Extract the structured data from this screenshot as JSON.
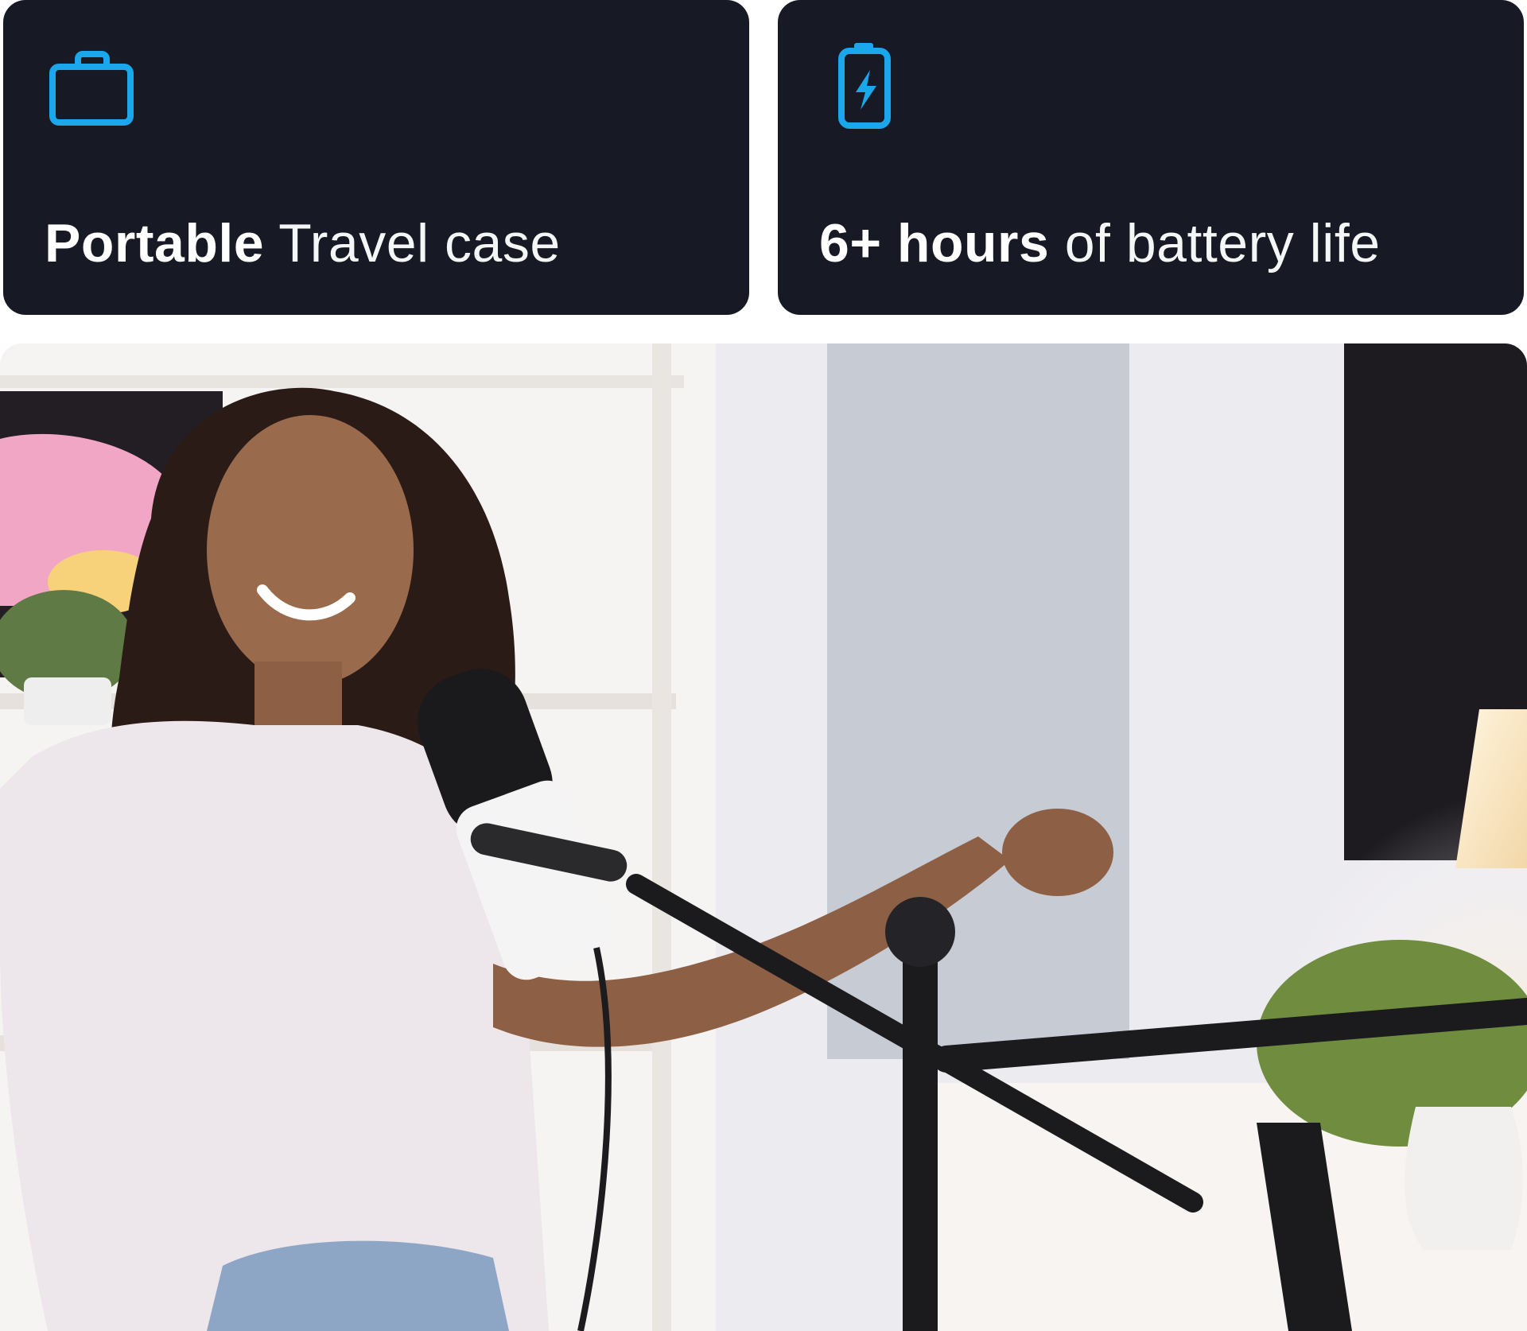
{
  "cards": [
    {
      "icon": "briefcase-icon",
      "strong": "Portable",
      "light": " Travel case"
    },
    {
      "icon": "battery-charging-icon",
      "strong": "6+ hours",
      "light": " of battery life"
    }
  ],
  "colors": {
    "card_background": "#171a24",
    "icon_accent": "#1aa7ec",
    "text": "#ffffff"
  },
  "photo": {
    "subject": "woman-with-podcast-microphone"
  }
}
